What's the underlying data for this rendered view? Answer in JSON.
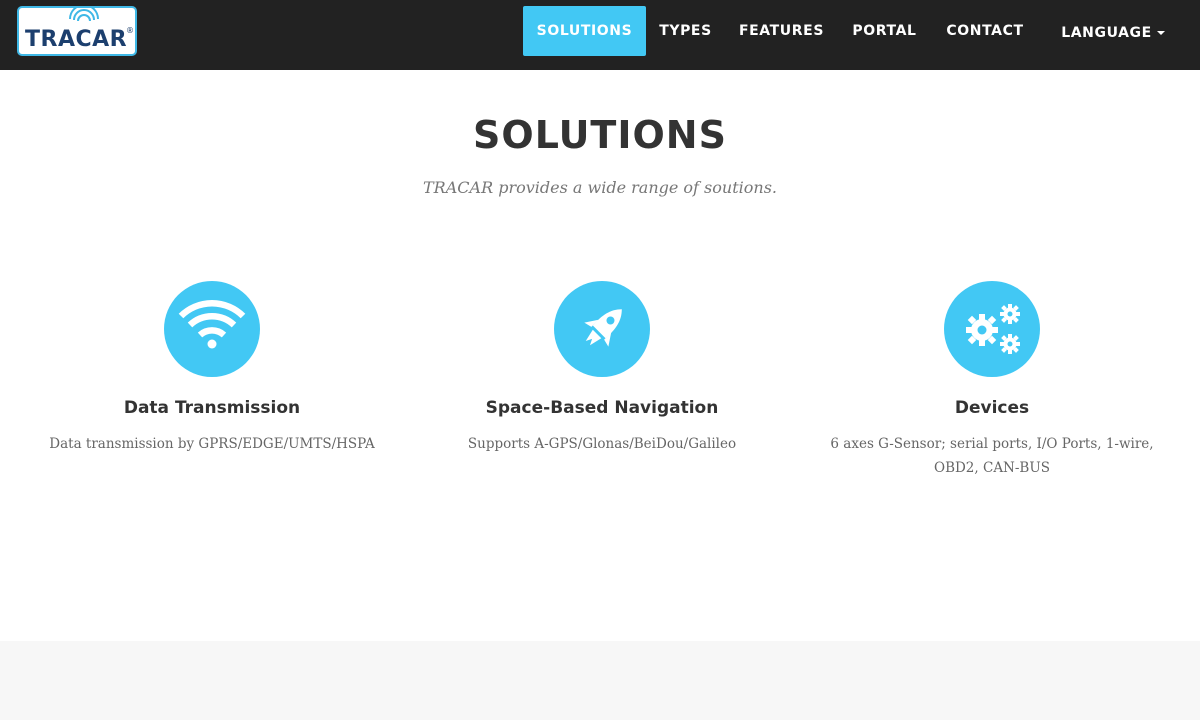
{
  "brand": {
    "logo_text": "TRACAR",
    "logo_mark": "®",
    "logo_color": "#1c3f6e",
    "logo_signal_color": "#3fb8e6"
  },
  "nav": {
    "items": [
      {
        "label": "SOLUTIONS",
        "active": true
      },
      {
        "label": "TYPES",
        "active": false
      },
      {
        "label": "FEATURES",
        "active": false
      },
      {
        "label": "PORTAL",
        "active": false
      },
      {
        "label": "CONTACT",
        "active": false
      }
    ],
    "language_label": "LANGUAGE",
    "background_color": "#222222",
    "active_color": "#42c8f4"
  },
  "section": {
    "title": "SOLUTIONS",
    "subtitle": "TRACAR provides a wide range of soutions."
  },
  "features": [
    {
      "icon": "wifi-icon",
      "heading": "Data Transmission",
      "text": "Data transmission by GPRS/EDGE/UMTS/HSPA"
    },
    {
      "icon": "rocket-icon",
      "heading": "Space-Based Navigation",
      "text": "Supports A-GPS/Glonas/BeiDou/Galileo"
    },
    {
      "icon": "gears-icon",
      "heading": "Devices",
      "text": "6 axes G-Sensor; serial ports, I/O Ports, 1-wire, OBD2, CAN-BUS"
    }
  ],
  "colors": {
    "accent": "#42c8f4",
    "heading": "#333333",
    "body_text": "#666666",
    "footer_band": "#f7f7f7"
  }
}
